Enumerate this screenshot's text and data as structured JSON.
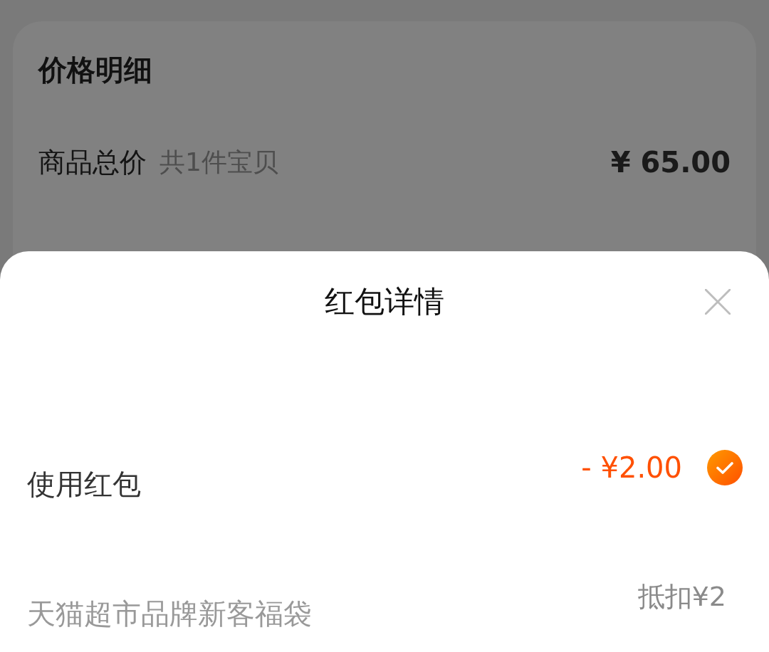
{
  "price_card": {
    "title": "价格明细",
    "rows": [
      {
        "label": "商品总价",
        "note": "共1件宝贝",
        "amount": "¥ 65.00"
      }
    ]
  },
  "sheet": {
    "title": "红包详情",
    "items": [
      {
        "kind": "toggle",
        "label": "使用红包",
        "amount": "- ¥2.00",
        "checked": true
      },
      {
        "kind": "coupon",
        "label": "天猫超市品牌新客福袋",
        "amount": "抵扣¥2"
      }
    ]
  }
}
